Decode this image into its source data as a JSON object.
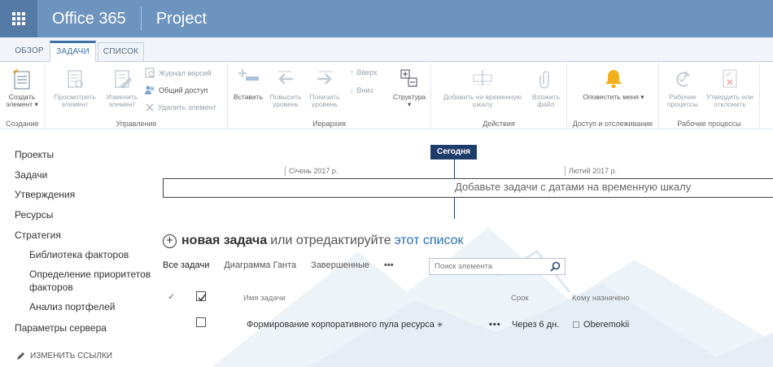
{
  "suite": {
    "brand": "Office 365",
    "app": "Project",
    "waffle_icon": "app-launcher-icon"
  },
  "tabs": [
    {
      "label": "ОБЗОР",
      "active": false
    },
    {
      "label": "ЗАДАЧИ",
      "active": true
    },
    {
      "label": "СПИСОК",
      "active": false
    }
  ],
  "ribbon": {
    "groups": {
      "create": "Создание",
      "manage": "Управление",
      "hierarchy": "Иерархия",
      "actions": "Действия",
      "access": "Доступ и отслеживание",
      "workflows": "Рабочие процессы"
    },
    "create_item": "Создать элемент ▾",
    "view_item": "Просмотреть элемент",
    "edit_item": "Изменить элемент",
    "version_history": "Журнал версий",
    "shared_with": "Общий доступ",
    "delete_item": "Удалить элемент",
    "indent": "Вставить",
    "outdent_up": "Повысить уровень",
    "outdent_down": "Понизить уровень",
    "move_up": "Вверх",
    "move_down": "Вниз",
    "outline": "Структура",
    "add_timeline": "Добавить на временную шкалу",
    "attach_file": "Вложить файл",
    "alert_me": "Оповестить меня ▾",
    "workflows": "Рабочие процессы",
    "approve": "Утвердить или отклонить"
  },
  "leftnav": {
    "items": [
      "Проекты",
      "Задачи",
      "Утверждения",
      "Ресурсы",
      "Стратегия"
    ],
    "sub_items": [
      "Библиотека факторов",
      "Определение приоритетов факторов",
      "Анализ портфелей"
    ],
    "server_settings": "Параметры сервера",
    "edit_links": "ИЗМЕНИТЬ ССЫЛКИ"
  },
  "timeline": {
    "today": "Сегодня",
    "month1": "Січень 2017 р.",
    "month2": "Лютий 2017 р.",
    "hint": "Добавьте задачи с датами на временную шкалу"
  },
  "list": {
    "new_task": "новая задача",
    "or_edit": "или отредактируйте",
    "this_list": "этот список",
    "views": [
      "Все задачи",
      "Диаграмма Ганта",
      "Завершенные",
      "•••"
    ],
    "search_placeholder": "Поиск элемента",
    "columns": {
      "task_name": "Имя задачи",
      "due": "Срок",
      "assigned": "Кому назначено"
    },
    "rows": [
      {
        "name": "Формирование корпоративного пула ресурса",
        "due": "Через 6 дн.",
        "assigned": "Oberemokii"
      }
    ]
  },
  "colors": {
    "suitebar": "#6d93bf",
    "accent": "#3d6fa8",
    "today": "#1f3d6b"
  }
}
